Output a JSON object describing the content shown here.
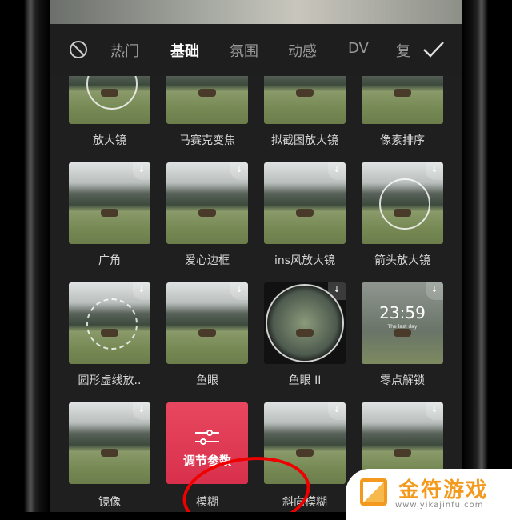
{
  "tabs": {
    "none_icon": "no-effect-icon",
    "items": [
      {
        "label": "热门"
      },
      {
        "label": "基础",
        "active": true
      },
      {
        "label": "氛围"
      },
      {
        "label": "动感"
      },
      {
        "label": "DV"
      },
      {
        "label": "复"
      }
    ],
    "confirm_icon": "check-icon"
  },
  "effects": [
    {
      "label": "放大镜"
    },
    {
      "label": "马赛克变焦"
    },
    {
      "label": "拟截图放大镜"
    },
    {
      "label": "像素排序"
    },
    {
      "label": "广角"
    },
    {
      "label": "爱心边框"
    },
    {
      "label": "ins风放大镜"
    },
    {
      "label": "箭头放大镜"
    },
    {
      "label": "圆形虚线放.."
    },
    {
      "label": "鱼眼"
    },
    {
      "label": "鱼眼 II"
    },
    {
      "label": "零点解锁",
      "clock": "23:59",
      "sub": "The last day"
    },
    {
      "label": "镜像"
    },
    {
      "label": "模糊",
      "selected": true,
      "action": "调节参数"
    },
    {
      "label": "斜向模糊"
    },
    {
      "label": ""
    }
  ],
  "accent": "#e0405a",
  "watermark": {
    "name": "金符游戏",
    "url": "www.yikajinfu.com"
  }
}
